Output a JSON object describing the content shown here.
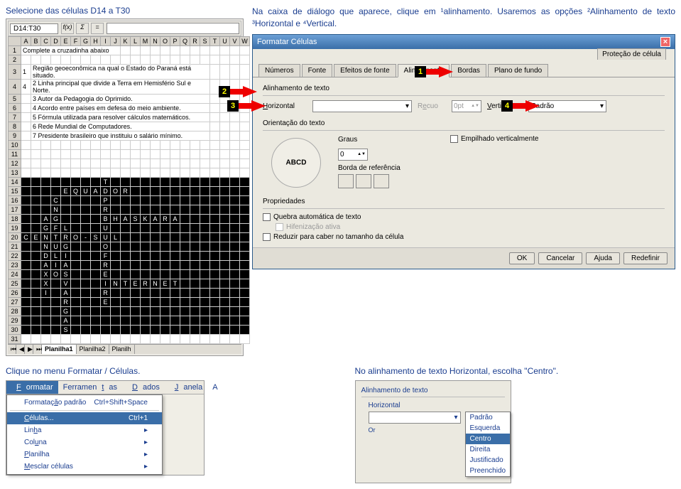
{
  "instructions": {
    "select_cells": "Selecione das células D14 a T30",
    "dialog_intro": "Na caixa de diálogo que aparece, clique em ¹alinhamento. Usaremos as opções ²Alinhamento de texto ³Horizontal e ⁴Vertical.",
    "click_format": "Clique no menu Formatar / Células.",
    "horiz_center": "No alinhamento de texto Horizontal, escolha \"Centro\"."
  },
  "spreadsheet": {
    "namebox": "D14:T30",
    "fx": "f(x)",
    "sigma": "Σ",
    "eq": "=",
    "cols": [
      "A",
      "B",
      "C",
      "D",
      "E",
      "F",
      "G",
      "H",
      "I",
      "J",
      "K",
      "L",
      "M",
      "N",
      "O",
      "P",
      "Q",
      "R",
      "S",
      "T",
      "U",
      "V",
      "W"
    ],
    "rows": [
      {
        "n": "1",
        "cells": [
          {
            "c": 1,
            "t": "Complete a cruzadinha abaixo",
            "span": 10,
            "cls": "leftcell"
          }
        ]
      },
      {
        "n": "2",
        "cells": []
      },
      {
        "n": "3",
        "cells": [
          {
            "c": 1,
            "t": "1",
            "cls": "leftcell"
          },
          {
            "c": 2,
            "t": "Região geoeconômica na qual o Estado do Paraná está situado.",
            "span": 18,
            "cls": "leftcell"
          }
        ]
      },
      {
        "n": "4",
        "cells": [
          {
            "c": 1,
            "t": "4",
            "cls": "leftcell"
          },
          {
            "c": 2,
            "t": "2 Linha principal que divide a Terra em Hemisfério Sul e Norte.",
            "span": 18,
            "cls": "leftcell"
          }
        ]
      },
      {
        "n": "5",
        "cells": [
          {
            "c": 1,
            "t": "",
            "cls": "leftcell"
          },
          {
            "c": 2,
            "t": "3 Autor da Pedagogia do Oprimido.",
            "span": 18,
            "cls": "leftcell"
          }
        ]
      },
      {
        "n": "6",
        "cells": [
          {
            "c": 1,
            "t": "",
            "cls": "leftcell"
          },
          {
            "c": 2,
            "t": "4 Acordo entre países em defesa do meio ambiente.",
            "span": 18,
            "cls": "leftcell"
          }
        ]
      },
      {
        "n": "7",
        "cells": [
          {
            "c": 1,
            "t": "",
            "cls": "leftcell"
          },
          {
            "c": 2,
            "t": "5 Fórmula utilizada para resolver cálculos matemáticos.",
            "span": 18,
            "cls": "leftcell"
          }
        ]
      },
      {
        "n": "8",
        "cells": [
          {
            "c": 1,
            "t": "",
            "cls": "leftcell"
          },
          {
            "c": 2,
            "t": "6 Rede Mundial de Computadores.",
            "span": 18,
            "cls": "leftcell"
          }
        ]
      },
      {
        "n": "9",
        "cells": [
          {
            "c": 1,
            "t": "",
            "cls": "leftcell"
          },
          {
            "c": 2,
            "t": "7 Presidente brasileiro que instituiu o salário mínimo.",
            "span": 18,
            "cls": "leftcell"
          }
        ]
      },
      {
        "n": "10",
        "cells": []
      },
      {
        "n": "11",
        "cells": []
      },
      {
        "n": "12",
        "cells": []
      },
      {
        "n": "13",
        "cells": []
      },
      {
        "n": "14",
        "black": true,
        "cells": [
          {
            "c": 9,
            "t": "T"
          }
        ]
      },
      {
        "n": "15",
        "black": true,
        "cells": [
          {
            "c": 5,
            "t": "E"
          },
          {
            "c": 6,
            "t": "Q"
          },
          {
            "c": 7,
            "t": "U"
          },
          {
            "c": 8,
            "t": "A"
          },
          {
            "c": 9,
            "t": "D"
          },
          {
            "c": 10,
            "t": "O"
          },
          {
            "c": 11,
            "t": "R"
          }
        ]
      },
      {
        "n": "16",
        "black": true,
        "cells": [
          {
            "c": 4,
            "t": "C"
          },
          {
            "c": 9,
            "t": "P"
          }
        ]
      },
      {
        "n": "17",
        "black": true,
        "cells": [
          {
            "c": 4,
            "t": "N"
          },
          {
            "c": 9,
            "t": "R"
          }
        ]
      },
      {
        "n": "18",
        "black": true,
        "cells": [
          {
            "c": 3,
            "t": "A"
          },
          {
            "c": 4,
            "t": "G"
          },
          {
            "c": 9,
            "t": "B"
          },
          {
            "c": 10,
            "t": "H"
          },
          {
            "c": 11,
            "t": "A"
          },
          {
            "c": 12,
            "t": "S"
          },
          {
            "c": 13,
            "t": "K"
          },
          {
            "c": 14,
            "t": "A"
          },
          {
            "c": 15,
            "t": "R"
          },
          {
            "c": 16,
            "t": "A"
          }
        ]
      },
      {
        "n": "19",
        "black": true,
        "cells": [
          {
            "c": 3,
            "t": "G"
          },
          {
            "c": 4,
            "t": "F"
          },
          {
            "c": 5,
            "t": "L"
          },
          {
            "c": 9,
            "t": "U"
          }
        ]
      },
      {
        "n": "20",
        "black": true,
        "cells": [
          {
            "c": 1,
            "t": "C"
          },
          {
            "c": 2,
            "t": "E"
          },
          {
            "c": 3,
            "t": "N"
          },
          {
            "c": 4,
            "t": "T"
          },
          {
            "c": 5,
            "t": "R"
          },
          {
            "c": 6,
            "t": "O"
          },
          {
            "c": 7,
            "t": "-"
          },
          {
            "c": 8,
            "t": "S"
          },
          {
            "c": 9,
            "t": "U"
          },
          {
            "c": 10,
            "t": "L"
          }
        ]
      },
      {
        "n": "21",
        "black": true,
        "cells": [
          {
            "c": 3,
            "t": "N"
          },
          {
            "c": 4,
            "t": "U"
          },
          {
            "c": 5,
            "t": "G"
          },
          {
            "c": 9,
            "t": "O"
          }
        ]
      },
      {
        "n": "22",
        "black": true,
        "cells": [
          {
            "c": 3,
            "t": "D"
          },
          {
            "c": 4,
            "t": "L"
          },
          {
            "c": 5,
            "t": "I"
          },
          {
            "c": 9,
            "t": "F"
          }
        ]
      },
      {
        "n": "23",
        "black": true,
        "cells": [
          {
            "c": 3,
            "t": "A"
          },
          {
            "c": 4,
            "t": "I"
          },
          {
            "c": 5,
            "t": "A"
          },
          {
            "c": 9,
            "t": "R"
          }
        ]
      },
      {
        "n": "24",
        "black": true,
        "cells": [
          {
            "c": 3,
            "t": "X"
          },
          {
            "c": 4,
            "t": "O"
          },
          {
            "c": 5,
            "t": "S"
          },
          {
            "c": 9,
            "t": "E"
          }
        ]
      },
      {
        "n": "25",
        "black": true,
        "cells": [
          {
            "c": 3,
            "t": "X"
          },
          {
            "c": 5,
            "t": "V"
          },
          {
            "c": 9,
            "t": "I"
          },
          {
            "c": 10,
            "t": "N"
          },
          {
            "c": 11,
            "t": "T"
          },
          {
            "c": 12,
            "t": "E"
          },
          {
            "c": 13,
            "t": "R"
          },
          {
            "c": 14,
            "t": "N"
          },
          {
            "c": 15,
            "t": "E"
          },
          {
            "c": 16,
            "t": "T"
          }
        ]
      },
      {
        "n": "26",
        "black": true,
        "cells": [
          {
            "c": 3,
            "t": "I"
          },
          {
            "c": 5,
            "t": "A"
          },
          {
            "c": 9,
            "t": "R"
          }
        ]
      },
      {
        "n": "27",
        "black": true,
        "cells": [
          {
            "c": 5,
            "t": "R"
          },
          {
            "c": 9,
            "t": "E"
          }
        ]
      },
      {
        "n": "28",
        "black": true,
        "cells": [
          {
            "c": 5,
            "t": "G"
          }
        ]
      },
      {
        "n": "29",
        "black": true,
        "cells": [
          {
            "c": 5,
            "t": "A"
          }
        ]
      },
      {
        "n": "30",
        "black": true,
        "cells": [
          {
            "c": 5,
            "t": "S"
          }
        ]
      },
      {
        "n": "31",
        "cells": []
      }
    ],
    "tabs": [
      "Planilha1",
      "Planilha2",
      "Planilh"
    ]
  },
  "dialog": {
    "title": "Formatar Células",
    "tabs": [
      "Números",
      "Fonte",
      "Efeitos de fonte",
      "Alinhamento",
      "Bordas",
      "Plano de fundo",
      "Proteção de célula"
    ],
    "section_align": "Alinhamento de texto",
    "horiz_label": "Horizontal",
    "horiz_value": "",
    "recuo_label": "Recuo",
    "recuo_value": "0pt",
    "vert_label": "Vertical",
    "vert_value": "Padrão",
    "section_orient": "Orientação do texto",
    "dial_text": "ABCD",
    "graus_label": "Graus",
    "graus_value": "0",
    "empilhado": "Empilhado verticalmente",
    "borda_ref": "Borda de referência",
    "section_props": "Propriedades",
    "quebra": "Quebra automática de texto",
    "hifen": "Hifenização ativa",
    "reduzir": "Reduzir para caber no tamanho da célula",
    "buttons": {
      "ok": "OK",
      "cancel": "Cancelar",
      "help": "Ajuda",
      "reset": "Redefinir"
    }
  },
  "callouts": {
    "c1": "1",
    "c2": "2",
    "c3": "3",
    "c4": "4"
  },
  "menu": {
    "bar": [
      "Formatar",
      "Ferramentas",
      "Dados",
      "Janela",
      "A"
    ],
    "items": [
      {
        "label": "Formatação padrão",
        "shortcut": "Ctrl+Shift+Space"
      },
      {
        "sep": true
      },
      {
        "label": "Células...",
        "shortcut": "Ctrl+1",
        "hl": true
      },
      {
        "label": "Linha",
        "sub": true
      },
      {
        "label": "Coluna",
        "sub": true
      },
      {
        "label": "Planilha",
        "sub": true
      },
      {
        "label": "Mesclar células",
        "sub": true
      }
    ]
  },
  "align_panel": {
    "section": "Alinhamento de texto",
    "horiz": "Horizontal",
    "or": "Or",
    "options": [
      "Padrão",
      "Esquerda",
      "Centro",
      "Direita",
      "Justificado",
      "Preenchido"
    ]
  }
}
